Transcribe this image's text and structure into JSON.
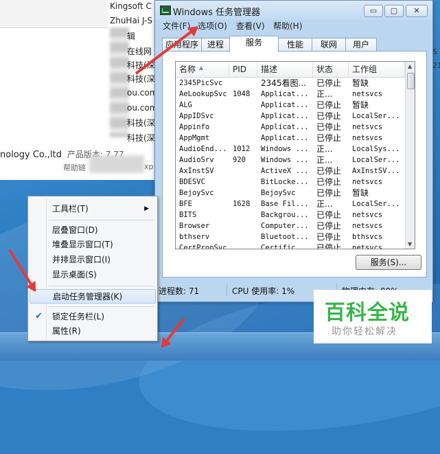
{
  "background_window": {
    "lines": [
      "Kingsoft C",
      "ZhuHai J-S",
      "辑",
      "在线网",
      "科技(深",
      "科技(深",
      "ou.com",
      "ou.com",
      "科技(深",
      "科技(深"
    ],
    "company": "nology Co.,ltd",
    "version": "产品版本: 7.77",
    "help": "帮助链",
    "right_chars": "S\n21",
    "tail": "xp"
  },
  "task_manager": {
    "title": "Windows 任务管理器",
    "window_buttons": {
      "minimize": "▭",
      "maximize": "▢",
      "close": "✕"
    },
    "menus": [
      "文件(F)",
      "选项(O)",
      "查看(V)",
      "帮助(H)"
    ],
    "tabs": [
      "应用程序",
      "进程",
      "服务",
      "性能",
      "联网",
      "用户"
    ],
    "active_tab": "服务",
    "columns": [
      "名称",
      "PID",
      "描述",
      "状态",
      "工作组"
    ],
    "rows": [
      [
        "2345PicSvc",
        "",
        "2345看图...",
        "已停止",
        "暂缺"
      ],
      [
        "AeLookupSvc",
        "1048",
        "Applicat...",
        "正...",
        "netsvcs"
      ],
      [
        "ALG",
        "",
        "Applicat...",
        "已停止",
        "暂缺"
      ],
      [
        "AppIDSvc",
        "",
        "Applicat...",
        "已停止",
        "LocalSer..."
      ],
      [
        "Appinfo",
        "",
        "Applicat...",
        "已停止",
        "netsvcs"
      ],
      [
        "AppMgmt",
        "",
        "Applicat...",
        "已停止",
        "netsvcs"
      ],
      [
        "AudioEnd...",
        "1012",
        "Windows ...",
        "正...",
        "LocalSys..."
      ],
      [
        "AudioSrv",
        "920",
        "Windows ...",
        "正...",
        "LocalSer..."
      ],
      [
        "AxInstSV",
        "",
        "ActiveX ...",
        "已停止",
        "AxInstSV..."
      ],
      [
        "BDESVC",
        "",
        "BitLocke...",
        "已停止",
        "netsvcs"
      ],
      [
        "BejoySvc",
        "",
        "BejoySvc",
        "已停止",
        "暂缺"
      ],
      [
        "BFE",
        "1628",
        "Base Fil...",
        "正...",
        "LocalSer..."
      ],
      [
        "BITS",
        "",
        "Backgrou...",
        "已停止",
        "netsvcs"
      ],
      [
        "Browser",
        "",
        "Computer...",
        "已停止",
        "netsvcs"
      ],
      [
        "bthserv",
        "",
        "Bluetoot...",
        "已停止",
        "bthsvcs"
      ],
      [
        "CertPropSvc",
        "",
        "Certific...",
        "已停止",
        "netsvcs"
      ]
    ],
    "services_button": "服务(S)...",
    "status": {
      "processes": "进程数: 71",
      "cpu": "CPU 使用率: 1%",
      "memory": "物理内存: 80%"
    }
  },
  "context_menu": {
    "items": [
      "工具栏(T)",
      "层叠窗口(D)",
      "堆叠显示窗口(T)",
      "并排显示窗口(I)",
      "显示桌面(S)",
      "启动任务管理器(K)",
      "锁定任务栏(L)",
      "属性(R)"
    ],
    "highlighted": "启动任务管理器(K)",
    "checked": "锁定任务栏(L)"
  },
  "watermark": {
    "title": "百科全说",
    "subtitle": "助你轻松解决"
  }
}
